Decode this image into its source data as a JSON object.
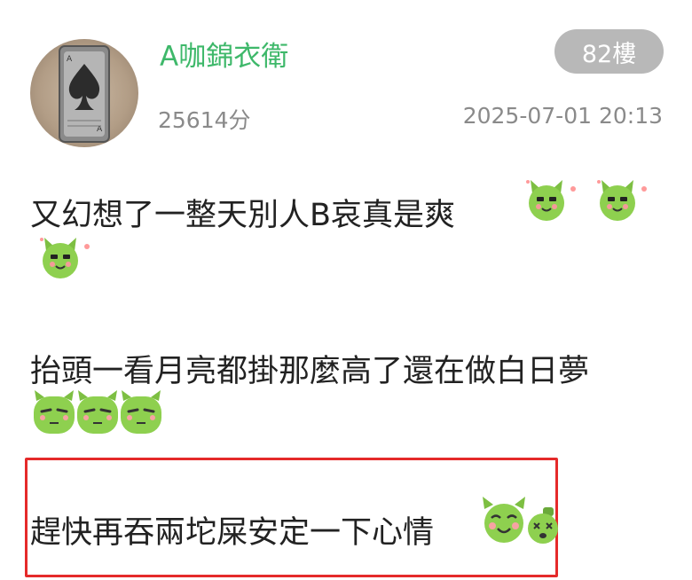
{
  "post": {
    "username": "A咖錦衣衛",
    "floor": "82樓",
    "score": "25614分",
    "timestamp": "2025-07-01 20:13"
  },
  "content": {
    "line1": "又幻想了一整天別人B哀真是爽",
    "line2": "抬頭一看月亮都掛那麼高了還在做白日夢",
    "line3": "趕快再吞兩坨屎安定一下心情"
  },
  "icons": {
    "avatar": "spade-lighter-icon",
    "emoji_smile": "green-devil-smile-icon",
    "emoji_tired": "green-devil-tired-icon",
    "emoji_happy": "green-devil-happy-icon",
    "emoji_dizzy": "green-devil-dizzy-icon"
  },
  "colors": {
    "username": "#3eb86a",
    "badge_bg": "#b8b8b8",
    "meta_text": "#8a8a8a",
    "body_text": "#222222",
    "highlight": "#e52a2a",
    "emoji_green": "#8ed04f"
  }
}
